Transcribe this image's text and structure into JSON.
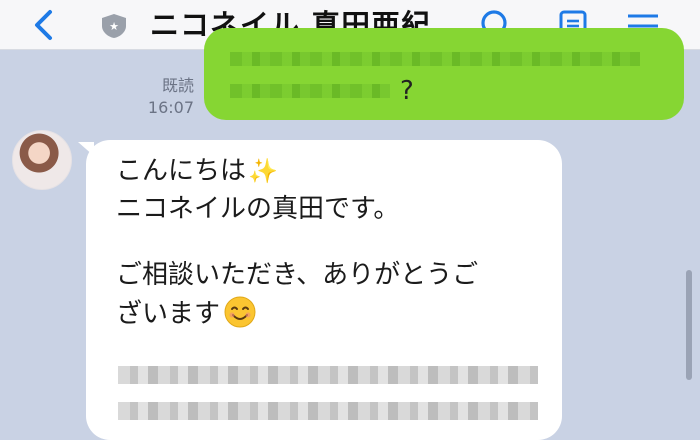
{
  "header": {
    "title": "ニコネイル 真田亜紀",
    "icons": [
      "back-icon",
      "shield-icon",
      "search-icon",
      "notes-icon",
      "menu-icon"
    ],
    "accent_color": "#1e7ae6"
  },
  "sent_message": {
    "read_status": "既読",
    "time": "16:07",
    "visible_text": "?",
    "bubble_color": "#86d633"
  },
  "received_message": {
    "line1": "こんにちは",
    "line2": "ニコネイルの真田です。",
    "line3": "ご相談いただき、ありがとうご",
    "line4": "ざいます",
    "sparkle": "✨",
    "bubble_color": "#ffffff"
  }
}
